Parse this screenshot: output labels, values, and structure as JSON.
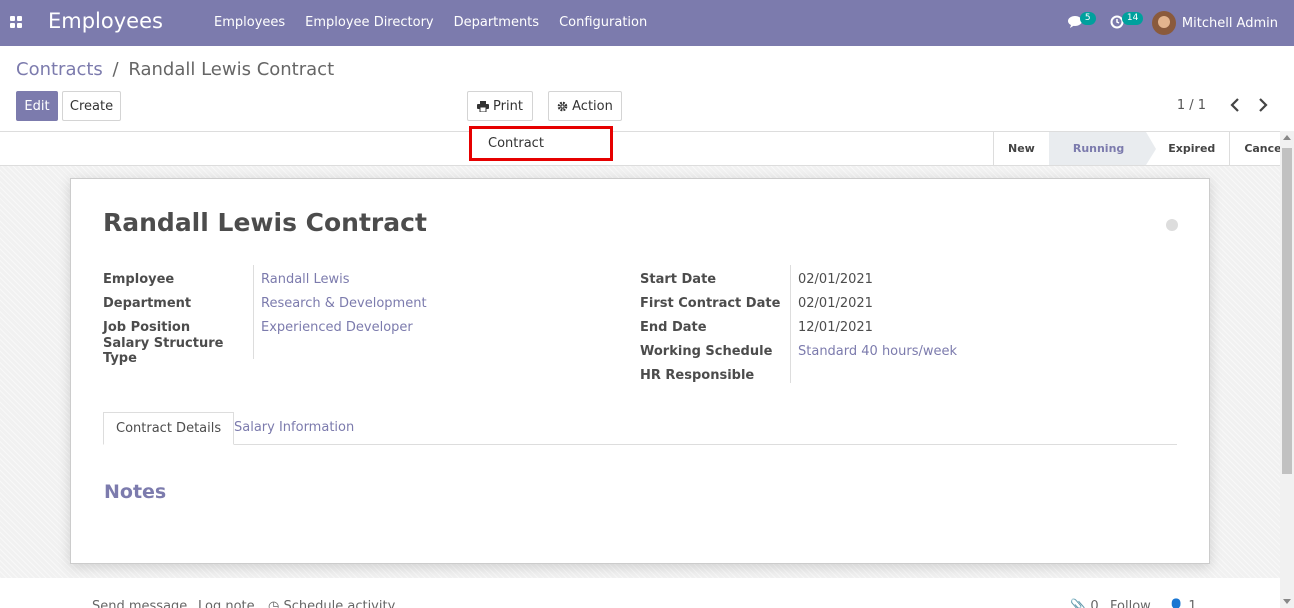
{
  "navbar": {
    "app_name": "Employees",
    "menu": [
      "Employees",
      "Employee Directory",
      "Departments",
      "Configuration"
    ],
    "messages_count": "5",
    "activities_count": "14",
    "user_name": "Mitchell Admin",
    "color": "#7c7bad"
  },
  "breadcrumb": {
    "parent": "Contracts",
    "separator": "/",
    "current": "Randall Lewis Contract"
  },
  "toolbar": {
    "edit_label": "Edit",
    "create_label": "Create",
    "print_label": "Print",
    "action_label": "Action",
    "pager": "1 / 1"
  },
  "print_dropdown": {
    "items": [
      "Contract"
    ],
    "highlight_color": "#e60000"
  },
  "statusbar": {
    "stages": [
      "New",
      "Running",
      "Expired",
      "Cancelled"
    ],
    "active_stage": "Running"
  },
  "record": {
    "title": "Randall Lewis Contract",
    "left_fields": [
      {
        "label": "Employee",
        "value": "Randall Lewis"
      },
      {
        "label": "Department",
        "value": "Research & Development"
      },
      {
        "label": "Job Position",
        "value": "Experienced Developer"
      },
      {
        "label": "Salary Structure Type",
        "value": ""
      }
    ],
    "right_fields": [
      {
        "label": "Start Date",
        "value": "02/01/2021"
      },
      {
        "label": "First Contract Date",
        "value": "02/01/2021"
      },
      {
        "label": "End Date",
        "value": "12/01/2021"
      },
      {
        "label": "Working Schedule",
        "value": "Standard 40 hours/week"
      },
      {
        "label": "HR Responsible",
        "value": ""
      }
    ],
    "tabs": [
      "Contract Details",
      "Salary Information"
    ],
    "notes_heading": "Notes"
  },
  "chatter": {
    "send_message": "Send message",
    "log_note": "Log note",
    "schedule_activity": "Schedule activity",
    "attachments_count": "0",
    "follow": "Follow",
    "followers_count": "1"
  }
}
